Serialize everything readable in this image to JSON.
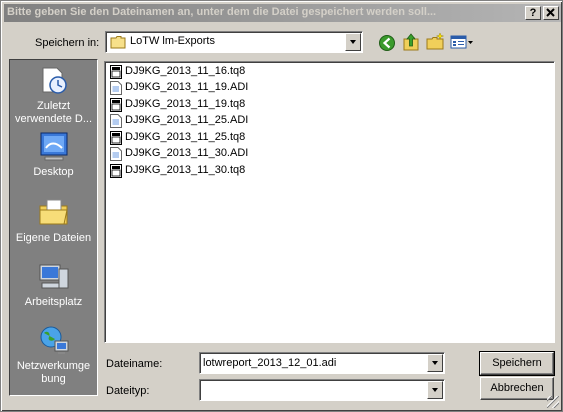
{
  "window": {
    "title": "Bitte geben Sie den Dateinamen an, unter dem die Datei gespeichert werden soll...",
    "help_label": "?",
    "close_label": "X"
  },
  "toolbar": {
    "save_in_label": "Speichern in:",
    "folder": "LoTW lm-Exports",
    "icons": [
      "back-icon",
      "up-folder-icon",
      "new-folder-icon",
      "view-menu-icon"
    ]
  },
  "places": [
    {
      "label": "Zuletzt verwendete D...",
      "icon": "recent-documents-icon"
    },
    {
      "label": "Desktop",
      "icon": "desktop-icon"
    },
    {
      "label": "Eigene Dateien",
      "icon": "my-documents-icon"
    },
    {
      "label": "Arbeitsplatz",
      "icon": "my-computer-icon"
    },
    {
      "label": "Netzwerkumge bung",
      "icon": "network-places-icon"
    }
  ],
  "files": [
    {
      "name": "DJ9KG_2013_11_16.tq8",
      "type": "tq8"
    },
    {
      "name": "DJ9KG_2013_11_19.ADI",
      "type": "adi"
    },
    {
      "name": "DJ9KG_2013_11_19.tq8",
      "type": "tq8"
    },
    {
      "name": "DJ9KG_2013_11_25.ADI",
      "type": "adi"
    },
    {
      "name": "DJ9KG_2013_11_25.tq8",
      "type": "tq8"
    },
    {
      "name": "DJ9KG_2013_11_30.ADI",
      "type": "adi"
    },
    {
      "name": "DJ9KG_2013_11_30.tq8",
      "type": "tq8"
    }
  ],
  "form": {
    "filename_label": "Dateiname:",
    "filename_value": "lotwreport_2013_12_01.adi",
    "filetype_label": "Dateityp:",
    "filetype_value": ""
  },
  "buttons": {
    "save": "Speichern",
    "cancel": "Abbrechen"
  }
}
